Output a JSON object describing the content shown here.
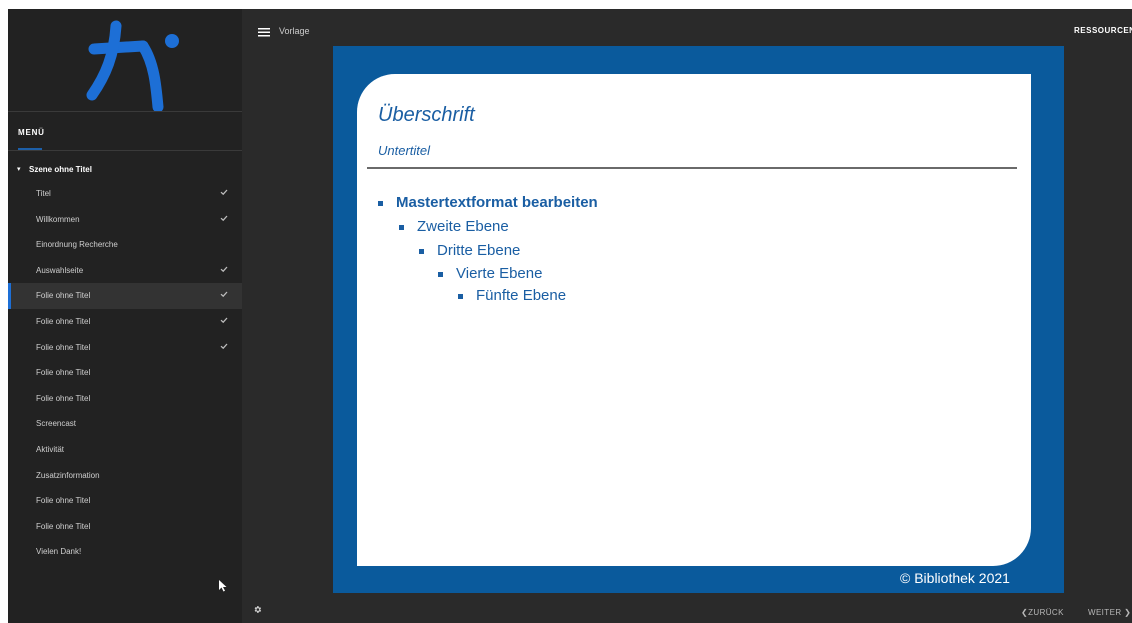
{
  "sidebar": {
    "menu_title": "MENÜ",
    "scene_title": "Szene ohne Titel",
    "items": [
      {
        "label": "Titel",
        "done": true,
        "active": false
      },
      {
        "label": "Willkommen",
        "done": true,
        "active": false
      },
      {
        "label": "Einordnung Recherche",
        "done": false,
        "active": false
      },
      {
        "label": "Auswahlseite",
        "done": true,
        "active": false
      },
      {
        "label": "Folie ohne Titel",
        "done": true,
        "active": true
      },
      {
        "label": "Folie ohne Titel",
        "done": true,
        "active": false
      },
      {
        "label": "Folie ohne Titel",
        "done": true,
        "active": false
      },
      {
        "label": "Folie ohne Titel",
        "done": false,
        "active": false
      },
      {
        "label": "Folie ohne Titel",
        "done": false,
        "active": false
      },
      {
        "label": "Screencast",
        "done": false,
        "active": false
      },
      {
        "label": "Aktivität",
        "done": false,
        "active": false
      },
      {
        "label": "Zusatzinformation",
        "done": false,
        "active": false
      },
      {
        "label": "Folie ohne Titel",
        "done": false,
        "active": false
      },
      {
        "label": "Folie ohne Titel",
        "done": false,
        "active": false
      },
      {
        "label": "Vielen Dank!",
        "done": false,
        "active": false
      }
    ]
  },
  "topbar": {
    "title": "Vorlage",
    "resources_label": "RESSOURCEN"
  },
  "slide": {
    "heading": "Überschrift",
    "subtitle": "Untertitel",
    "bullets": [
      "Mastertextformat bearbeiten",
      "Zweite Ebene",
      "Dritte Ebene",
      "Vierte Ebene",
      "Fünfte Ebene"
    ],
    "footer": "© Bibliothek 2021"
  },
  "bottombar": {
    "back_label": "ZURÜCK",
    "next_label": "WEITER"
  },
  "colors": {
    "accent": "#1d6fd6",
    "slide_blue": "#0a5a9c",
    "text_blue": "#1a5ea3",
    "sidebar_bg": "#222222",
    "app_bg": "#2a2a2a"
  }
}
